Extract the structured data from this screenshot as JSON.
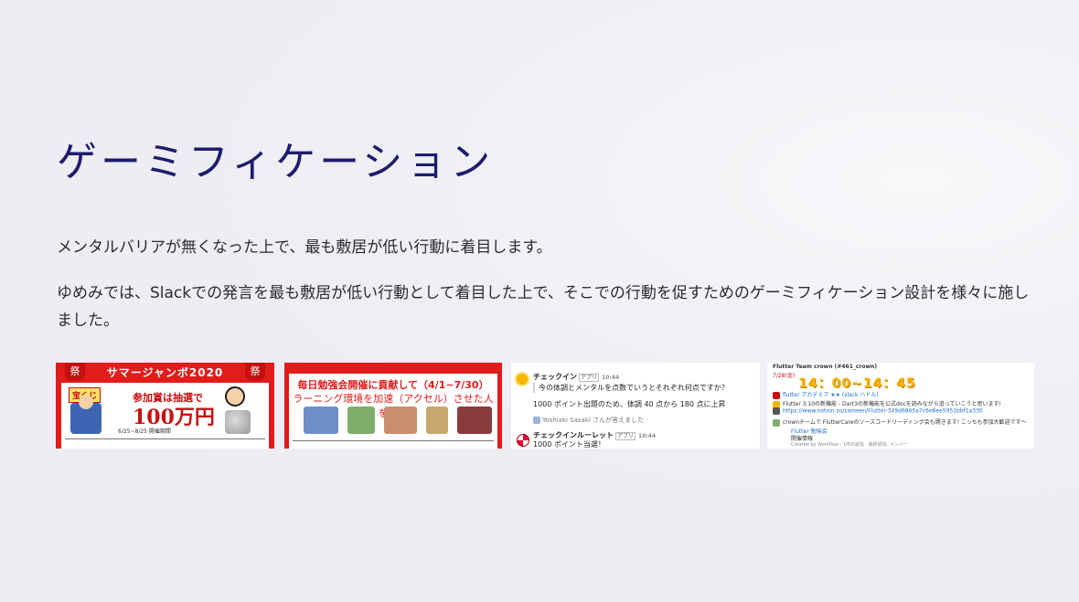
{
  "title": "ゲーミフィケーション",
  "paragraph1": "メンタルバリアが無くなった上で、最も敷居が低い行動に着目します。",
  "paragraph2": "ゆめみでは、Slackでの発言を最も敷居が低い行動として着目した上で、そこでの行動を促すためのゲーミフィケーション設計を様々に施しました。",
  "thumbnails": {
    "t1": {
      "banner": "サマージャンボ2020",
      "lantern": "祭",
      "tag": "宝くじ",
      "subtitle": "参加賞は抽選で",
      "amount": "100万円",
      "date": "6/25~8/25  開催期間"
    },
    "t2": {
      "line1": "毎日勉強会開催に貢献して（4/1~7/30）",
      "line2": "ラーニング環境を加速（アクセル）させた人を表彰"
    },
    "t3": {
      "checkin_name": "チェックイン",
      "app_badge": "アプリ",
      "time1": "10:44",
      "question": "今の体調とメンタルを点数でいうとそれぞれ何点ですか？",
      "points_text": "1000 ポイント出題のため、体調 40 点から 180 点に上昇",
      "answered": "Yoshiaki Sasaki さんが答えました",
      "roulette_name": "チェックインルーレット",
      "time2": "10:44",
      "win_text": "1000 ポイント当選！"
    },
    "t4": {
      "team": "Flutter Team crown (#461_crown)",
      "date_label": "7/28(金)",
      "time_range": "14：00~14：45",
      "huddle": "flutter アカデミア ★★ (slack ハドル)",
      "note": "Flutter 3.10の新機能 - Dart3の新機能を公式docを読みながら追っていこうと思います!",
      "url": "https://www.notion.so/zameen/Flutter-349d6865a7c6e8ee5951bbf1a330",
      "invite": "crownチームで FlutterCareのソースコードリーディング会も開きます! こっちも参加大歓迎です〜",
      "event_name": "Flutter 勉強会",
      "event_sub": "開催情報",
      "created": "Created by Workflow · 1件の返信 · 最終返信: メンバー"
    }
  }
}
